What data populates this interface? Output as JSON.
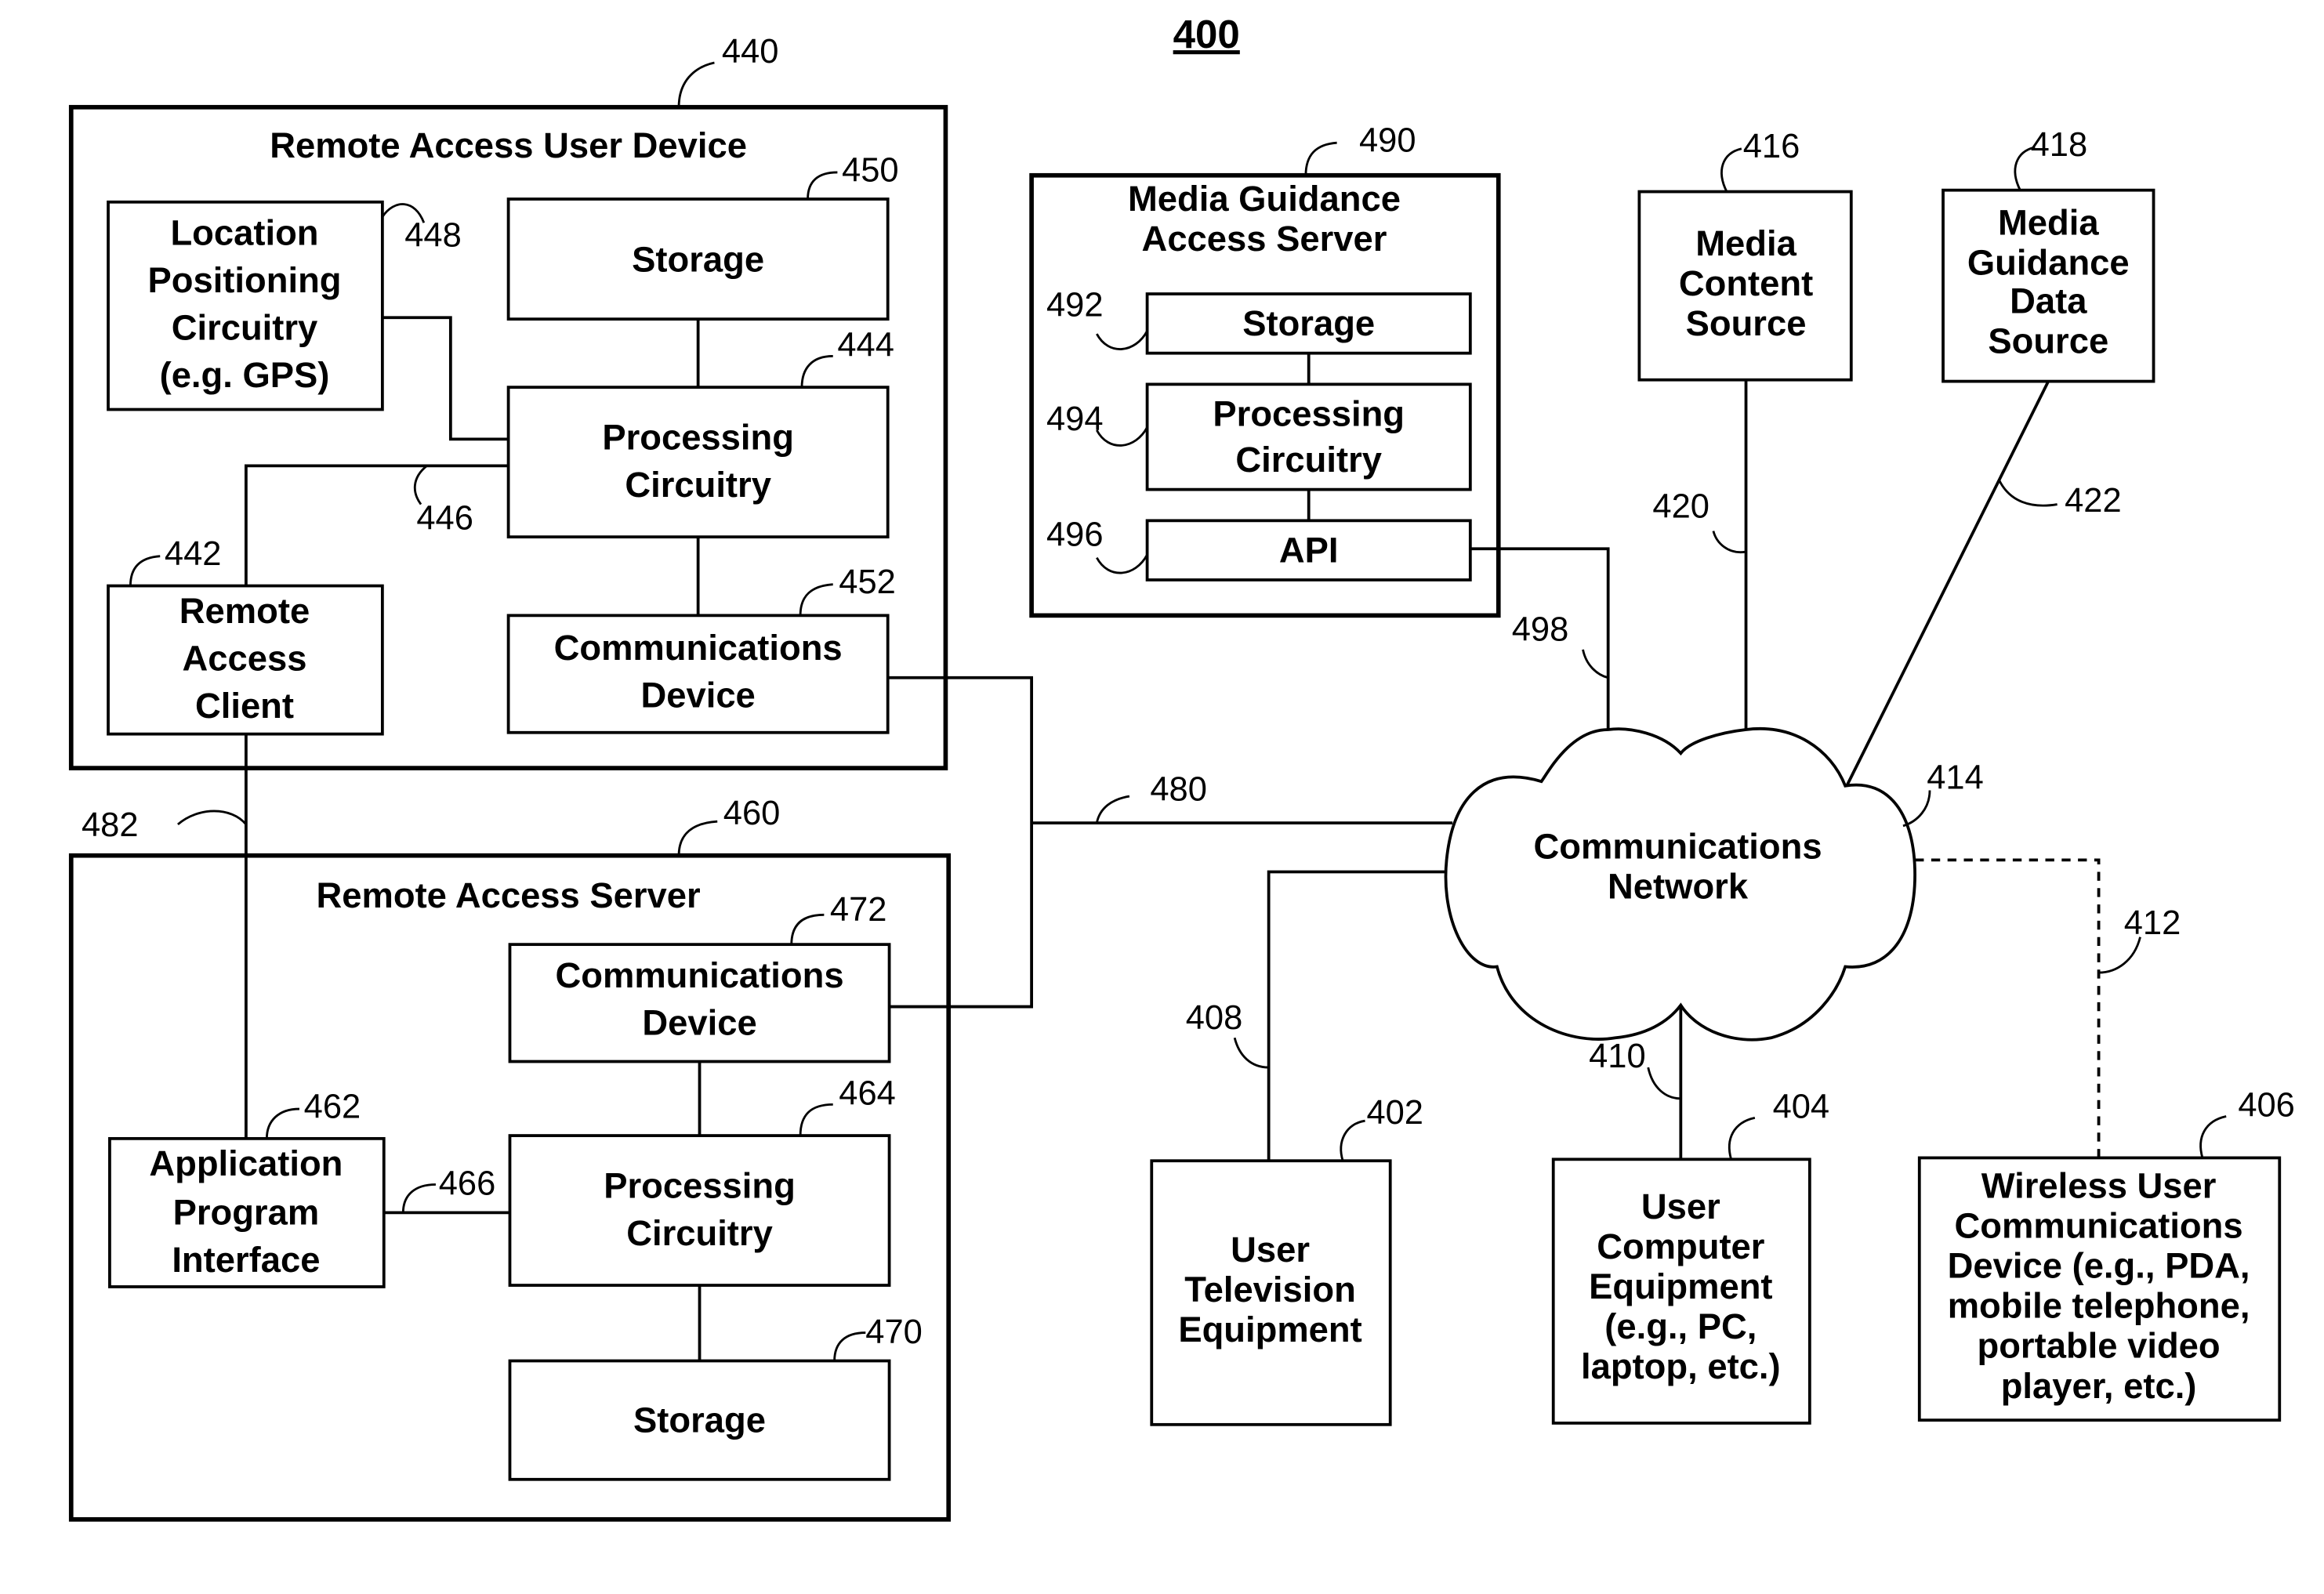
{
  "figure_number": "400",
  "remote_access_user_device": {
    "ref": "440",
    "title": "Remote Access User Device",
    "location_positioning": {
      "ref": "448",
      "lines": [
        "Location",
        "Positioning",
        "Circuitry",
        "(e.g. GPS)"
      ]
    },
    "storage": {
      "ref": "450",
      "lines": [
        "Storage"
      ]
    },
    "processing": {
      "ref": "444",
      "lines": [
        "Processing",
        "Circuitry"
      ]
    },
    "remote_access_client": {
      "ref": "442",
      "lines": [
        "Remote",
        "Access",
        "Client"
      ]
    },
    "communications_device": {
      "ref": "452",
      "lines": [
        "Communications",
        "Device"
      ]
    },
    "link_ref": "446"
  },
  "remote_access_server": {
    "ref": "460",
    "title": "Remote Access Server",
    "communications_device": {
      "ref": "472",
      "lines": [
        "Communications",
        "Device"
      ]
    },
    "api": {
      "ref": "462",
      "lines": [
        "Application",
        "Program",
        "Interface"
      ]
    },
    "processing": {
      "ref": "464",
      "lines": [
        "Processing",
        "Circuitry"
      ]
    },
    "storage": {
      "ref": "470",
      "lines": [
        "Storage"
      ]
    },
    "link_ref": "466"
  },
  "media_guidance_access_server": {
    "ref": "490",
    "title_lines": [
      "Media Guidance",
      "Access Server"
    ],
    "storage": {
      "ref": "492",
      "lines": [
        "Storage"
      ]
    },
    "processing": {
      "ref": "494",
      "lines": [
        "Processing",
        "Circuitry"
      ]
    },
    "api": {
      "ref": "496",
      "lines": [
        "API"
      ]
    }
  },
  "media_content_source": {
    "ref": "416",
    "lines": [
      "Media",
      "Content",
      "Source"
    ]
  },
  "media_guidance_data_source": {
    "ref": "418",
    "lines": [
      "Media",
      "Guidance",
      "Data",
      "Source"
    ]
  },
  "communications_network": {
    "ref": "414",
    "lines": [
      "Communications",
      "Network"
    ]
  },
  "user_television_equipment": {
    "ref": "402",
    "lines": [
      "User",
      "Television",
      "Equipment"
    ]
  },
  "user_computer_equipment": {
    "ref": "404",
    "lines": [
      "User",
      "Computer",
      "Equipment",
      "(e.g., PC,",
      "laptop, etc.)"
    ]
  },
  "wireless_user_device": {
    "ref": "406",
    "lines": [
      "Wireless User",
      "Communications",
      "Device (e.g., PDA,",
      "mobile telephone,",
      "portable video",
      "player, etc.)"
    ]
  },
  "links": {
    "link_480": "480",
    "link_482": "482",
    "link_498": "498",
    "link_420": "420",
    "link_422": "422",
    "link_408": "408",
    "link_410": "410",
    "link_412": "412"
  }
}
